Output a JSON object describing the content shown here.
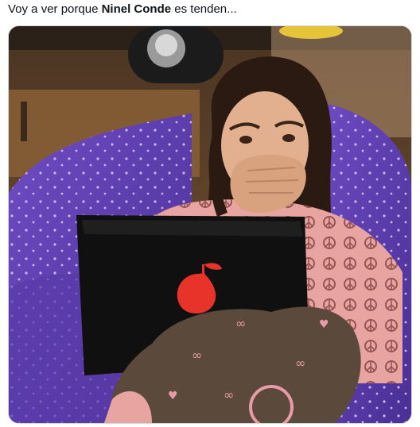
{
  "tweet": {
    "text_prefix": "Voy a ver porque ",
    "text_bold": "Ninel Conde",
    "text_suffix": " es tenden..."
  },
  "media": {
    "kind": "photo",
    "icon": "pear-logo-icon",
    "colors": {
      "beanbag": "#5a3aa8",
      "wall": "#6b4a2c",
      "laptop": "#101010",
      "pear_logo": "#e8332a",
      "pajama_top": "#e8a4a0",
      "pants": "#5b4a3c"
    }
  }
}
